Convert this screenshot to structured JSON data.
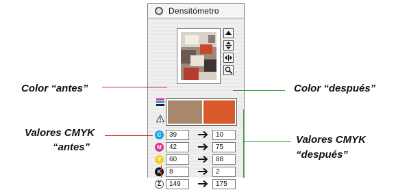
{
  "window": {
    "title": "Densitómetro"
  },
  "callouts": {
    "color_antes": "Color “antes”",
    "color_despues": "Color “después”",
    "cmyk_antes_line1": "Valores CMYK",
    "cmyk_antes_line2": "“antes”",
    "cmyk_despues_line1": "Valores CMYK",
    "cmyk_despues_line2": "“después”"
  },
  "swatches": {
    "before_color": "#a8876d",
    "after_color": "#d85a2a"
  },
  "callout_colors": {
    "red": "#d8202a",
    "green": "#3a9a3c"
  },
  "tools": [
    "scroll-up-icon",
    "fit-vertical-icon",
    "fit-horizontal-icon",
    "zoom-icon"
  ],
  "rows": [
    {
      "ink": "C",
      "color": "#1aa3e0",
      "before": "39",
      "after": "10"
    },
    {
      "ink": "M",
      "color": "#e0328c",
      "before": "42",
      "after": "75"
    },
    {
      "ink": "Y",
      "color": "#f2d020",
      "before": "60",
      "after": "88"
    },
    {
      "ink": "K",
      "color": "#111111",
      "before": "8",
      "after": "2"
    },
    {
      "ink": "Σ",
      "color": "#ffffff",
      "before": "149",
      "after": "175"
    }
  ],
  "arrow": "→"
}
